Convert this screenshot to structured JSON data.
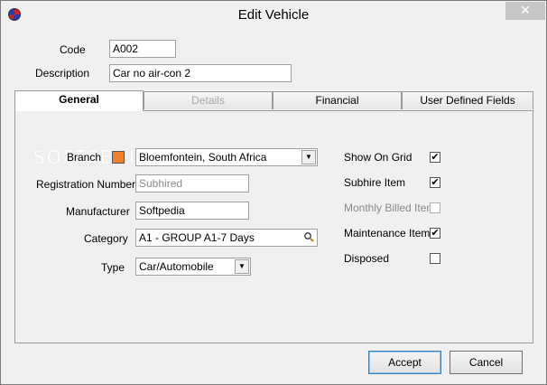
{
  "window": {
    "title": "Edit Vehicle",
    "close_glyph": "✕"
  },
  "header": {
    "code_label": "Code",
    "code_value": "A002",
    "description_label": "Description",
    "description_value": "Car no air-con 2"
  },
  "tabs": [
    {
      "label": "General",
      "state": "active"
    },
    {
      "label": "Details",
      "state": "disabled"
    },
    {
      "label": "Financial",
      "state": "normal"
    },
    {
      "label": "User Defined Fields",
      "state": "normal"
    }
  ],
  "general": {
    "watermark": "SOFTPEDIA",
    "branch_label": "Branch",
    "branch_value": "Bloemfontein,  South Africa",
    "branch_color": "#f08030",
    "registration_label": "Registration Number",
    "registration_value": "Subhired",
    "manufacturer_label": "Manufacturer",
    "manufacturer_value": "Softpedia",
    "category_label": "Category",
    "category_value": "A1  -  GROUP A1-7 Days",
    "type_label": "Type",
    "type_value": "Car/Automobile",
    "icons": {
      "dropdown": "chevron-down-icon",
      "search": "magnifier-icon"
    },
    "checks": [
      {
        "label": "Show On Grid",
        "checked": true,
        "enabled": true
      },
      {
        "label": "Subhire Item",
        "checked": true,
        "enabled": true
      },
      {
        "label": "Monthly Billed Item",
        "checked": false,
        "enabled": false
      },
      {
        "label": "Maintenance Item",
        "checked": true,
        "enabled": true
      },
      {
        "label": "Disposed",
        "checked": false,
        "enabled": true
      }
    ]
  },
  "footer": {
    "accept_label": "Accept",
    "cancel_label": "Cancel"
  }
}
